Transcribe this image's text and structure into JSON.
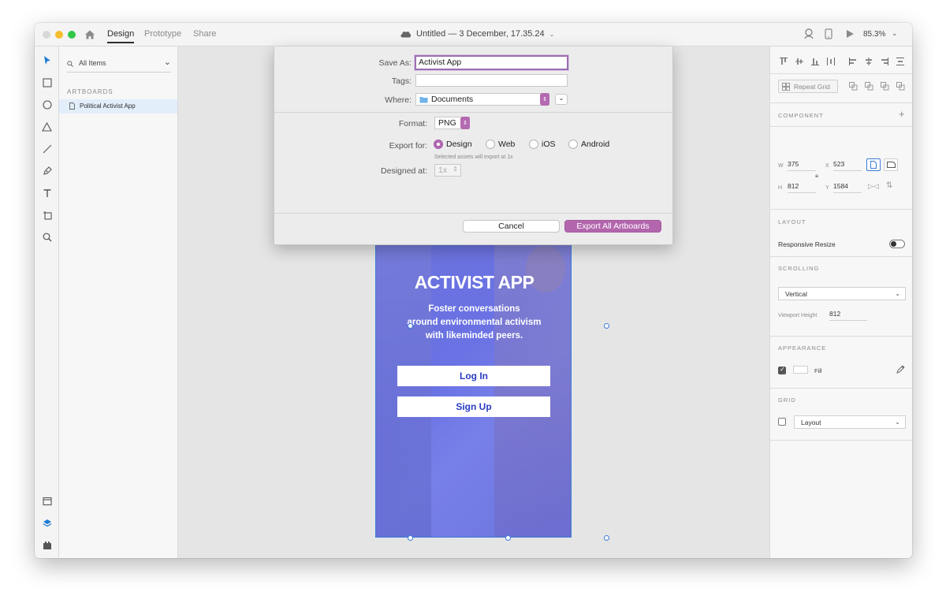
{
  "titlebar": {
    "tabs": [
      {
        "label": "Design",
        "active": true
      },
      {
        "label": "Prototype",
        "active": false
      },
      {
        "label": "Share",
        "active": false
      }
    ],
    "document_title": "Untitled — 3 December, 17.35.24",
    "zoom": "85.3%"
  },
  "tools": [
    "select-icon",
    "rectangle-icon",
    "ellipse-icon",
    "polygon-icon",
    "line-icon",
    "pen-icon",
    "text-icon",
    "artboard-icon",
    "zoom-icon",
    "assets-icon",
    "layers-icon",
    "plugins-icon"
  ],
  "layers": {
    "search_label": "All Items",
    "section_label": "ARTBOARDS",
    "items": [
      {
        "label": "Political Activist App",
        "selected": true
      }
    ]
  },
  "dialog": {
    "save_as_label": "Save As:",
    "save_as_value": "Activist App",
    "tags_label": "Tags:",
    "tags_value": "",
    "where_label": "Where:",
    "where_value": "Documents",
    "format_label": "Format:",
    "format_value": "PNG",
    "export_for_label": "Export for:",
    "export_options": [
      {
        "label": "Design",
        "selected": true
      },
      {
        "label": "Web",
        "selected": false
      },
      {
        "label": "iOS",
        "selected": false
      },
      {
        "label": "Android",
        "selected": false
      }
    ],
    "export_hint": "Selected assets will export at 1x",
    "designed_at_label": "Designed at:",
    "designed_at_value": "1x",
    "cancel_label": "Cancel",
    "export_label": "Export All Artboards"
  },
  "artboard": {
    "title": "ACTIVIST APP",
    "subtitle_lines": [
      "Foster conversations",
      "around environmental activism",
      "with likeminded peers."
    ],
    "login_label": "Log In",
    "signup_label": "Sign Up",
    "bg_color": "#6a72e4"
  },
  "inspector": {
    "repeat_grid_label": "Repeat Grid",
    "component_label": "COMPONENT",
    "w_label": "W",
    "w_value": "375",
    "x_label": "X",
    "x_value": "523",
    "h_label": "H",
    "h_value": "812",
    "y_label": "Y",
    "y_value": "1584",
    "layout_label": "LAYOUT",
    "responsive_resize_label": "Responsive Resize",
    "responsive_resize_on": false,
    "scrolling_label": "SCROLLING",
    "scrolling_value": "Vertical",
    "viewport_height_label": "Viewport Height",
    "viewport_height_value": "812",
    "appearance_label": "APPEARANCE",
    "fill_label": "Fill",
    "fill_checked": true,
    "grid_label": "GRID",
    "grid_value": "Layout",
    "grid_checked": false
  },
  "colors": {
    "accent": "#b366ad",
    "selection": "#3b7bd8",
    "tool_active": "#1e7ad6"
  }
}
